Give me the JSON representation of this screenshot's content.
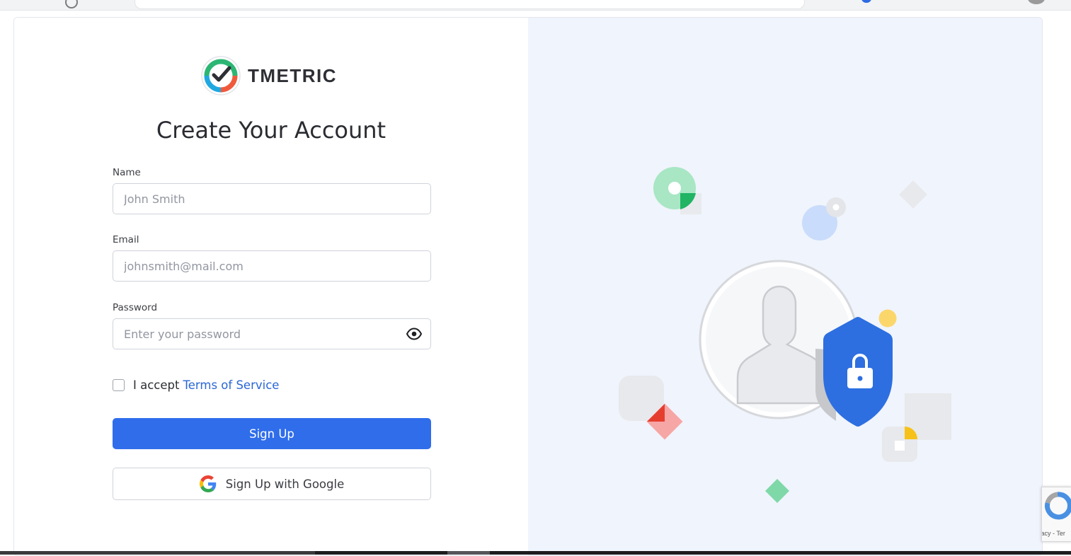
{
  "brand": {
    "name": "TMETRIC"
  },
  "page": {
    "title": "Create Your Account"
  },
  "form": {
    "name_label": "Name",
    "name_placeholder": "John Smith",
    "email_label": "Email",
    "email_placeholder": "johnsmith@mail.com",
    "password_label": "Password",
    "password_placeholder": "Enter your password",
    "accept_text": "I accept",
    "terms_link": "Terms of Service",
    "terms_checked": false,
    "signup_button": "Sign Up",
    "google_button": "Sign Up with Google"
  },
  "icons": {
    "logo": "tmetric-logo-icon",
    "password_toggle": "eye-icon",
    "google": "google-g-icon",
    "illustration": "user-shield-lock-icon",
    "recaptcha": "recaptcha-icon"
  },
  "recaptcha": {
    "footer": "vacy - Ter"
  },
  "colors": {
    "primary": "#2f6deb",
    "link": "#2a66d6",
    "panel_bg": "#f0f4fc",
    "shield": "#2d6fe0"
  }
}
